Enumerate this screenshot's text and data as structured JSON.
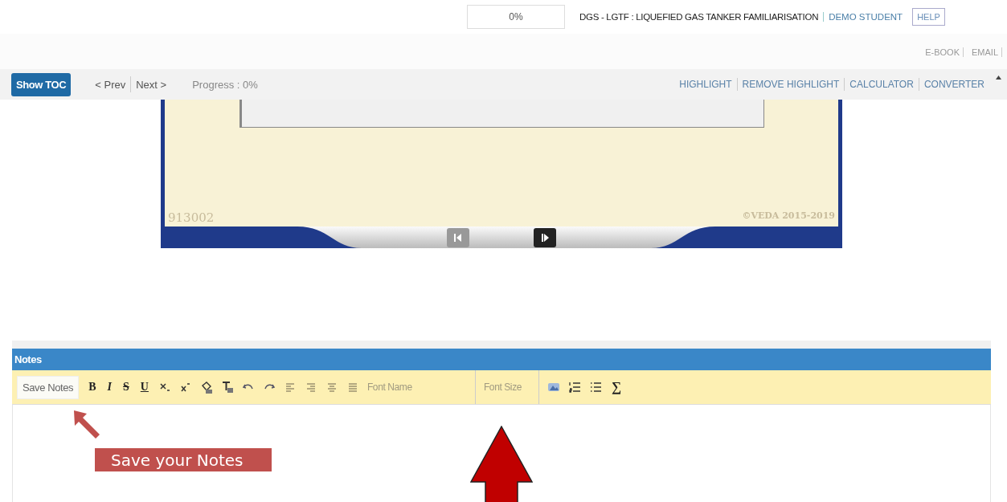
{
  "header": {
    "progress_box": "0%",
    "course_title": "DGS - LGTF : LIQUEFIED GAS TANKER FAMILIARISATION",
    "user": "DEMO STUDENT",
    "links": [
      "HELP"
    ]
  },
  "sub_links": [
    "E-BOOK",
    "EMAIL"
  ],
  "toolbar": {
    "toc_button": "Show TOC",
    "prev": "< Prev",
    "next": "Next >",
    "progress": "Progress : 0%",
    "actions": [
      "HIGHLIGHT",
      "REMOVE HIGHLIGHT",
      "CALCULATOR",
      "CONVERTER"
    ]
  },
  "slide": {
    "code": "913002",
    "copyright": "©VEDA 2015-2019",
    "prev_enabled": false,
    "next_enabled": true
  },
  "notes": {
    "title": "Notes",
    "save_button": "Save Notes",
    "font_name": "Font Name",
    "font_size": "Font Size",
    "tools": [
      {
        "kind": "letter",
        "label": "B"
      },
      {
        "kind": "letter",
        "label": "I"
      },
      {
        "kind": "letter",
        "label": "S"
      },
      {
        "kind": "letter",
        "label": "U"
      },
      {
        "kind": "icon"
      },
      {
        "kind": "icon"
      },
      {
        "kind": "icon"
      },
      {
        "kind": "icon"
      },
      {
        "kind": "icon"
      },
      {
        "kind": "icon"
      },
      {
        "kind": "icon"
      },
      {
        "kind": "icon"
      },
      {
        "kind": "icon"
      },
      {
        "kind": "icon"
      }
    ],
    "tools_after": [
      {
        "kind": "icon"
      },
      {
        "kind": "icon"
      },
      {
        "kind": "icon"
      },
      {
        "kind": "letter",
        "label": "∑"
      }
    ]
  },
  "annotations": [
    {
      "label": "Save your Notes"
    }
  ]
}
